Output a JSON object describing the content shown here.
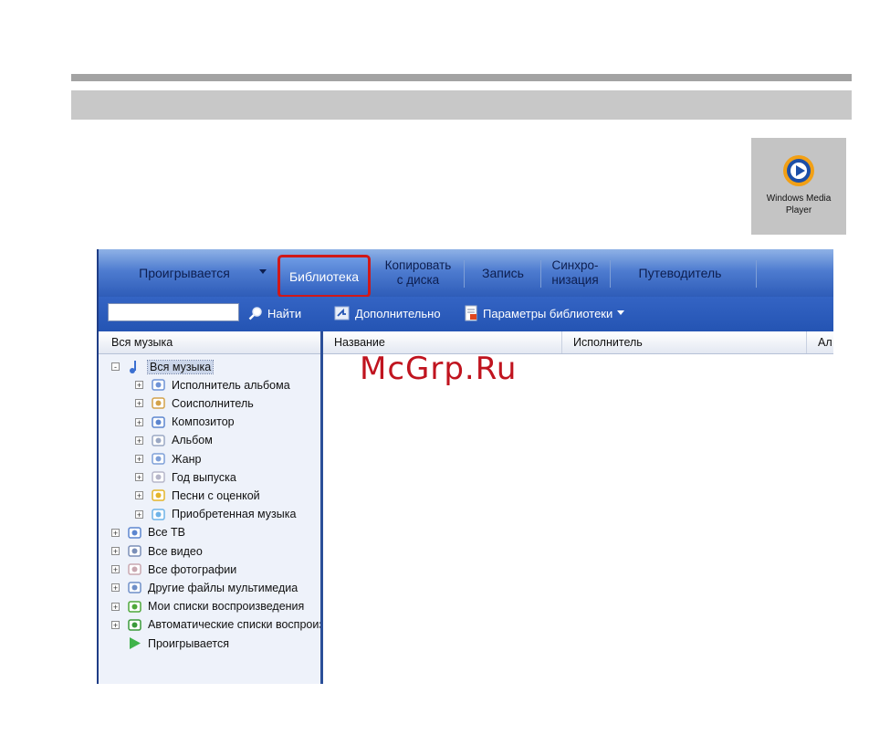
{
  "desktop_icon": {
    "label_line1": "Windows Media",
    "label_line2": "Player",
    "icon": "wmp-logo-icon"
  },
  "tabs": [
    {
      "label": "Проигрывается"
    },
    {
      "label": "Библиотека",
      "active": true
    },
    {
      "label_line1": "Копировать",
      "label_line2": "с диска"
    },
    {
      "label": "Запись"
    },
    {
      "label_line1": "Синхро-",
      "label_line2": "низация"
    },
    {
      "label": "Путеводитель"
    }
  ],
  "toolbar": {
    "search_value": "",
    "find_label": "Найти",
    "advanced_label": "Дополнительно",
    "library_options_label": "Параметры библиотеки"
  },
  "navpane": {
    "header": "Вся музыка",
    "tree": [
      {
        "label": "Вся музыка",
        "icon": "music-note-icon",
        "level": 0,
        "expander": "-"
      },
      {
        "label": "Исполнитель альбома",
        "icon": "artist-icon",
        "level": 1,
        "expander": "+"
      },
      {
        "label": "Соисполнитель",
        "icon": "contributing-artist-icon",
        "level": 1,
        "expander": "+"
      },
      {
        "label": "Композитор",
        "icon": "composer-icon",
        "level": 1,
        "expander": "+"
      },
      {
        "label": "Альбом",
        "icon": "album-icon",
        "level": 1,
        "expander": "+"
      },
      {
        "label": "Жанр",
        "icon": "genre-icon",
        "level": 1,
        "expander": "+"
      },
      {
        "label": "Год выпуска",
        "icon": "calendar-icon",
        "level": 1,
        "expander": "+"
      },
      {
        "label": "Песни с оценкой",
        "icon": "star-rating-icon",
        "level": 1,
        "expander": "+"
      },
      {
        "label": "Приобретенная музыка",
        "icon": "purchased-music-icon",
        "level": 1,
        "expander": "+"
      },
      {
        "label": "Все ТВ",
        "icon": "tv-icon",
        "level": 0,
        "expander": "+"
      },
      {
        "label": "Все видео",
        "icon": "video-icon",
        "level": 0,
        "expander": "+"
      },
      {
        "label": "Все фотографии",
        "icon": "photo-icon",
        "level": 0,
        "expander": "+"
      },
      {
        "label": "Другие файлы мультимедиа",
        "icon": "other-media-icon",
        "level": 0,
        "expander": "+"
      },
      {
        "label": "Мои списки воспроизведения",
        "icon": "playlist-icon",
        "level": 0,
        "expander": "+"
      },
      {
        "label": "Автоматические списки воспроизведения",
        "icon": "auto-playlist-icon",
        "level": 0,
        "expander": "+"
      },
      {
        "label": "Проигрывается",
        "icon": "play-icon",
        "level": 0,
        "expander": ""
      }
    ]
  },
  "content": {
    "columns": [
      {
        "label": "Название"
      },
      {
        "label": "Исполнитель"
      },
      {
        "label": "Ал"
      }
    ]
  },
  "watermark": "McGrp.Ru",
  "colors": {
    "accent": "#2f5ebf",
    "highlight_border": "#d01818",
    "watermark": "#c0141f"
  }
}
